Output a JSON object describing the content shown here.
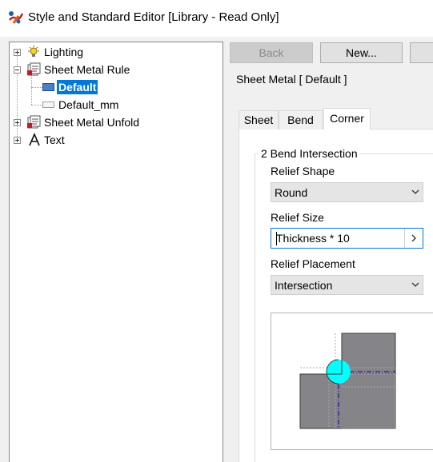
{
  "window": {
    "title": "Style and Standard Editor [Library - Read Only]"
  },
  "tree": {
    "items": [
      {
        "label": "Lighting"
      },
      {
        "label": "Sheet Metal Rule"
      },
      {
        "label": "Default"
      },
      {
        "label": "Default_mm"
      },
      {
        "label": "Sheet Metal Unfold"
      },
      {
        "label": "Text"
      }
    ]
  },
  "toolbar": {
    "back_label": "Back",
    "new_label": "New..."
  },
  "style": {
    "header": "Sheet Metal [ Default ]"
  },
  "tabs": [
    {
      "label": "Sheet"
    },
    {
      "label": "Bend"
    },
    {
      "label": "Corner"
    }
  ],
  "corner": {
    "group_title": "2 Bend Intersection",
    "relief_shape_label": "Relief Shape",
    "relief_shape_value": "Round",
    "relief_size_label": "Relief Size",
    "relief_size_value": "Thickness * 10",
    "relief_placement_label": "Relief Placement",
    "relief_placement_value": "Intersection"
  },
  "colors": {
    "selection": "#0078d7",
    "relief": "#00ffff",
    "plate": "#858489",
    "axis": "#0000cc"
  }
}
